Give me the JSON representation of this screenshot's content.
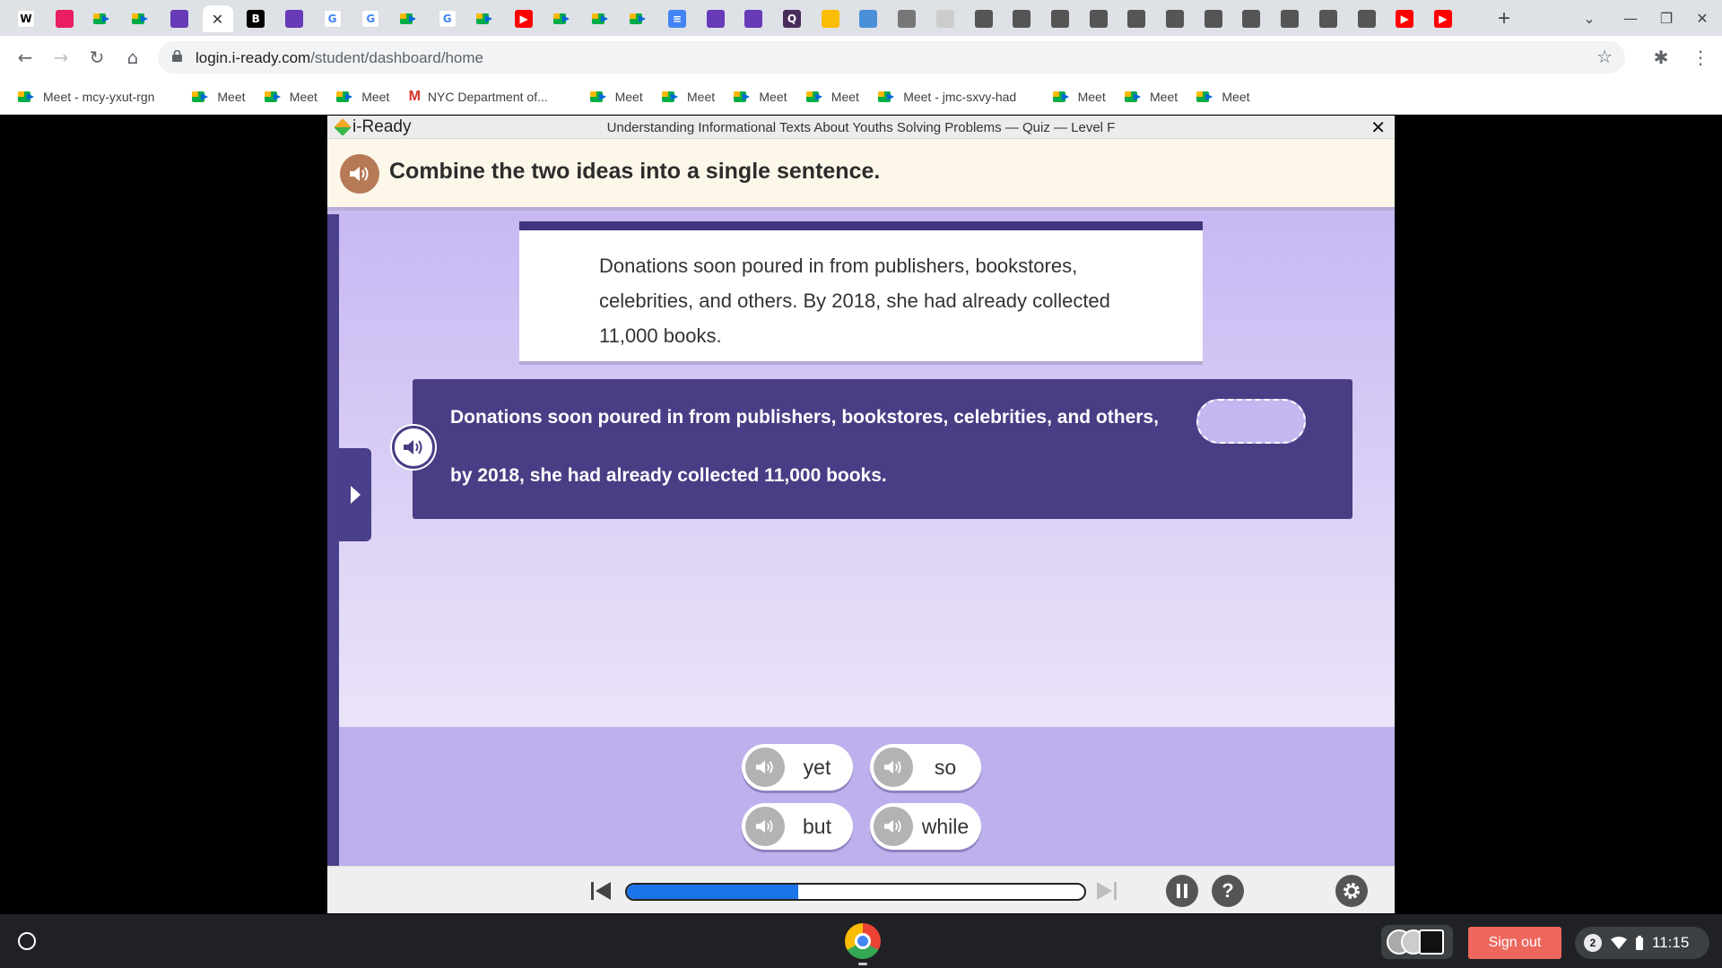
{
  "browser": {
    "tabs": [
      {
        "icon": "wikipedia-icon",
        "glyph": "W",
        "color": "#ffffff",
        "fg": "#000000"
      },
      {
        "icon": "contacts-icon",
        "glyph": "",
        "color": "#e91e63"
      },
      {
        "icon": "meet-icon",
        "glyph": "",
        "color": "meet"
      },
      {
        "icon": "meet-icon",
        "glyph": "",
        "color": "meet"
      },
      {
        "icon": "forms-icon",
        "glyph": "",
        "color": "#673ab7"
      },
      {
        "icon": "close-icon",
        "glyph": "",
        "color": "active"
      },
      {
        "icon": "b-icon",
        "glyph": "B",
        "color": "#000000"
      },
      {
        "icon": "forms-icon",
        "glyph": "",
        "color": "#673ab7"
      },
      {
        "icon": "google-icon",
        "glyph": "G",
        "color": "#ffffff",
        "fg": "#4285f4"
      },
      {
        "icon": "google-icon",
        "glyph": "G",
        "color": "#ffffff",
        "fg": "#4285f4"
      },
      {
        "icon": "meet-icon",
        "glyph": "",
        "color": "meet"
      },
      {
        "icon": "google-icon",
        "glyph": "G",
        "color": "#ffffff",
        "fg": "#4285f4"
      },
      {
        "icon": "meet-icon",
        "glyph": "",
        "color": "meet"
      },
      {
        "icon": "youtube-icon",
        "glyph": "▶",
        "color": "#ff0000"
      },
      {
        "icon": "meet-icon",
        "glyph": "",
        "color": "meet"
      },
      {
        "icon": "meet-icon",
        "glyph": "",
        "color": "meet"
      },
      {
        "icon": "meet-icon",
        "glyph": "",
        "color": "meet"
      },
      {
        "icon": "docs-icon",
        "glyph": "≡",
        "color": "#4285f4"
      },
      {
        "icon": "forms-icon",
        "glyph": "",
        "color": "#673ab7"
      },
      {
        "icon": "forms-icon",
        "glyph": "",
        "color": "#673ab7"
      },
      {
        "icon": "quizlet-icon",
        "glyph": "Q",
        "color": "#4a2c5a"
      },
      {
        "icon": "slides-icon",
        "glyph": "",
        "color": "#fbbc04"
      },
      {
        "icon": "globe-icon",
        "glyph": "",
        "color": "#4a90d9"
      },
      {
        "icon": "globe-icon",
        "glyph": "",
        "color": "#777777"
      },
      {
        "icon": "nyc-icon",
        "glyph": "",
        "color": "#cccccc"
      },
      {
        "icon": "roblox-icon",
        "glyph": "",
        "color": "#555555"
      },
      {
        "icon": "roblox-icon",
        "glyph": "",
        "color": "#555555"
      },
      {
        "icon": "roblox-icon",
        "glyph": "",
        "color": "#555555"
      },
      {
        "icon": "roblox-icon",
        "glyph": "",
        "color": "#555555"
      },
      {
        "icon": "roblox-icon",
        "glyph": "",
        "color": "#555555"
      },
      {
        "icon": "roblox-icon",
        "glyph": "",
        "color": "#555555"
      },
      {
        "icon": "roblox-icon",
        "glyph": "",
        "color": "#555555"
      },
      {
        "icon": "roblox-icon",
        "glyph": "",
        "color": "#555555"
      },
      {
        "icon": "roblox-icon",
        "glyph": "",
        "color": "#555555"
      },
      {
        "icon": "roblox-icon",
        "glyph": "",
        "color": "#555555"
      },
      {
        "icon": "roblox-icon",
        "glyph": "",
        "color": "#555555"
      },
      {
        "icon": "youtube-icon",
        "glyph": "▶",
        "color": "#ff0000"
      },
      {
        "icon": "youtube-icon",
        "glyph": "▶",
        "color": "#ff0000"
      }
    ],
    "url_host": "login.i-ready.com",
    "url_path": "/student/dashboard/home",
    "bookmarks": [
      {
        "icon": "meet",
        "label": "Meet - mcy-yxut-rgn"
      },
      {
        "icon": "meet",
        "label": "Meet"
      },
      {
        "icon": "meet",
        "label": "Meet"
      },
      {
        "icon": "meet",
        "label": "Meet"
      },
      {
        "icon": "gmail",
        "label": "NYC Department of..."
      },
      {
        "icon": "meet",
        "label": "Meet"
      },
      {
        "icon": "meet",
        "label": "Meet"
      },
      {
        "icon": "meet",
        "label": "Meet"
      },
      {
        "icon": "meet",
        "label": "Meet"
      },
      {
        "icon": "meet",
        "label": "Meet - jmc-sxvy-had"
      },
      {
        "icon": "meet",
        "label": "Meet"
      },
      {
        "icon": "meet",
        "label": "Meet"
      },
      {
        "icon": "meet",
        "label": "Meet"
      }
    ]
  },
  "app": {
    "logo_text": "i-Ready",
    "lesson_title": "Understanding Informational Texts About Youths Solving Problems — Quiz — Level F",
    "close_glyph": "✕",
    "prompt": "Combine the two ideas into a single sentence.",
    "passage": "Donations soon poured in from publishers, bookstores, celebrities, and others. By 2018, she had already collected 11,000 books.",
    "sentence_part1": "Donations soon poured in from publishers, bookstores, celebrities, and others,",
    "sentence_part2": "by 2018, she had already collected 11,000 books.",
    "choices": [
      "yet",
      "so",
      "but",
      "while"
    ],
    "progress_fraction": 0.375,
    "help_glyph": "?"
  },
  "os": {
    "signout_label": "Sign out",
    "notification_count": "2",
    "clock": "11:15"
  },
  "colors": {
    "accent_purple": "#4a3d85",
    "progress_blue": "#1b74e8",
    "signout_red": "#ee675c"
  }
}
